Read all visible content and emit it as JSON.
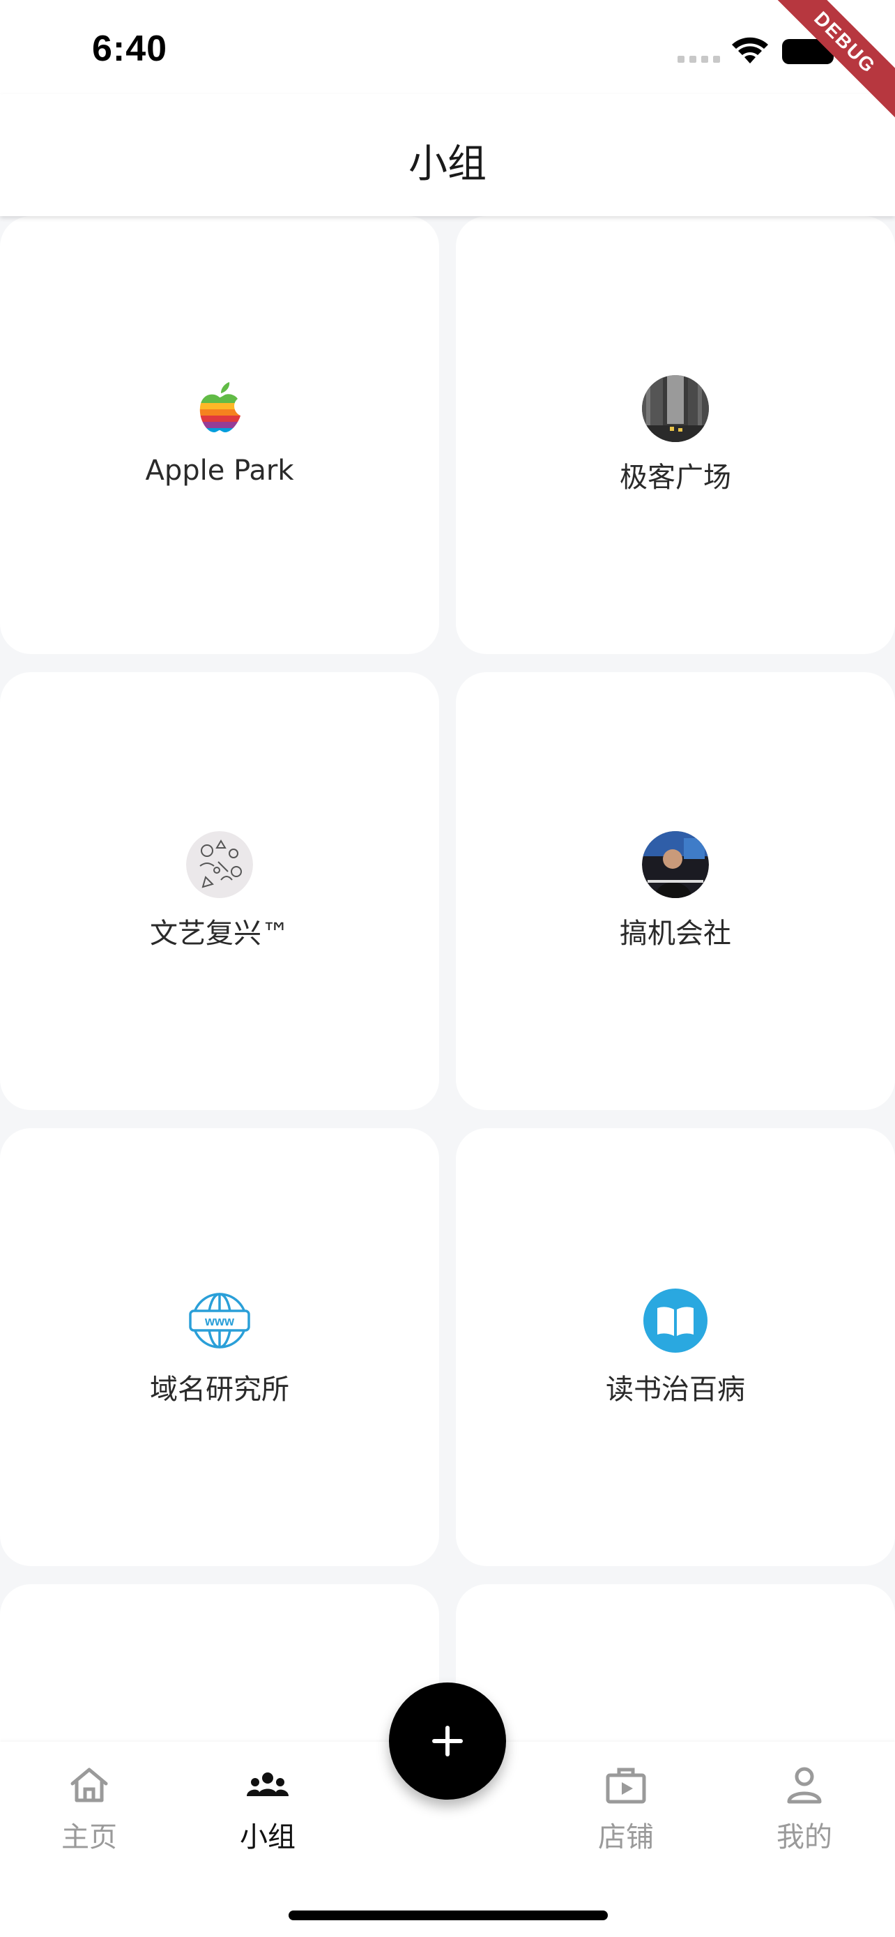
{
  "status_bar": {
    "time": "6:40"
  },
  "debug_banner": "DEBUG",
  "header": {
    "title": "小组"
  },
  "groups": [
    {
      "name": "Apple Park",
      "icon": "apple-logo-icon"
    },
    {
      "name": "极客广场",
      "icon": "city-street-avatar"
    },
    {
      "name": "文艺复兴™",
      "icon": "doodle-avatar"
    },
    {
      "name": "搞机会社",
      "icon": "person-photo-avatar"
    },
    {
      "name": "域名研究所",
      "icon": "www-globe-icon"
    },
    {
      "name": "读书治百病",
      "icon": "open-book-icon"
    },
    {
      "name": "",
      "icon": ""
    },
    {
      "name": "",
      "icon": ""
    }
  ],
  "bottom_nav": {
    "items": [
      {
        "label": "主页",
        "icon": "home-icon",
        "active": false
      },
      {
        "label": "小组",
        "icon": "group-icon",
        "active": true
      },
      {
        "label": "店铺",
        "icon": "store-icon",
        "active": false
      },
      {
        "label": "我的",
        "icon": "profile-icon",
        "active": false
      }
    ],
    "fab_icon": "plus-icon"
  },
  "colors": {
    "accent": "#000000",
    "background": "#f5f6f8",
    "inactive": "#9a9a9a",
    "debug": "#b7373f"
  }
}
